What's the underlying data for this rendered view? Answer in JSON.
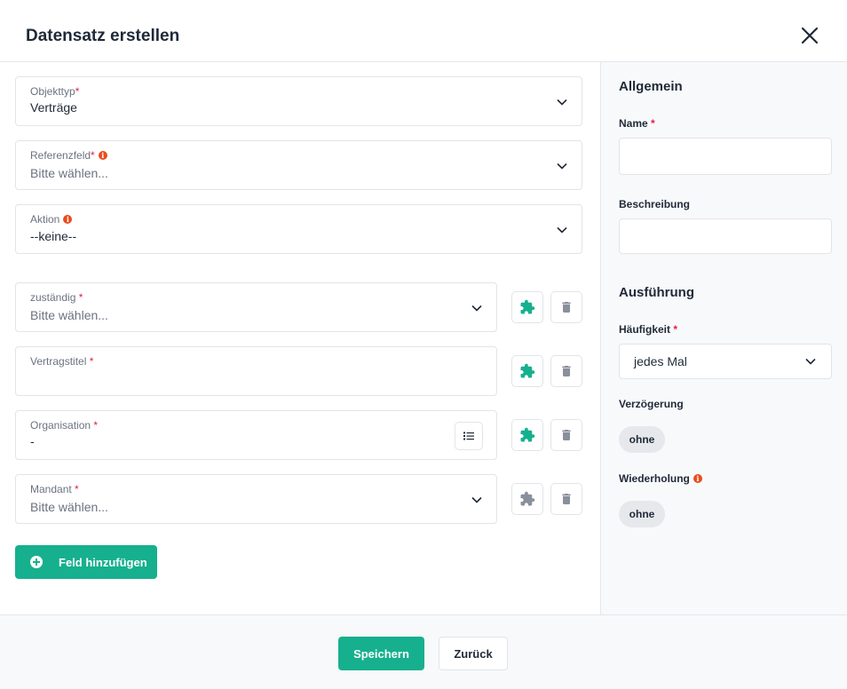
{
  "dialog": {
    "title": "Datensatz erstellen"
  },
  "required_mark": "*",
  "info_glyph": "i",
  "fields": {
    "objekttyp": {
      "label": "Objekttyp",
      "value": "Verträge"
    },
    "referenzfeld": {
      "label": "Referenzfeld",
      "placeholder": "Bitte wählen..."
    },
    "aktion": {
      "label": "Aktion",
      "value": "--keine--"
    },
    "zustaendig": {
      "label": "zuständig",
      "placeholder": "Bitte wählen..."
    },
    "vertragstitel": {
      "label": "Vertragstitel",
      "value": ""
    },
    "organisation": {
      "label": "Organisation",
      "value": "-"
    },
    "mandant": {
      "label": "Mandant",
      "placeholder": "Bitte wählen..."
    }
  },
  "add_field_button": "Feld hinzufügen",
  "sidebar": {
    "general_title": "Allgemein",
    "name_label": "Name",
    "name_value": "",
    "description_label": "Beschreibung",
    "description_value": "",
    "execution_title": "Ausführung",
    "frequency_label": "Häufigkeit",
    "frequency_value": "jedes Mal",
    "delay_label": "Verzögerung",
    "delay_value": "ohne",
    "repeat_label": "Wiederholung",
    "repeat_value": "ohne"
  },
  "footer": {
    "save": "Speichern",
    "back": "Zurück"
  },
  "colors": {
    "accent": "#16b08e",
    "required": "#e11d48",
    "info": "#ea4c1d",
    "puzzle_active": "#16b08e",
    "puzzle_inactive": "#8a8f9c",
    "trash": "#8a8f9c"
  },
  "icons": {
    "close": "close-icon",
    "chevron": "chevron-down-icon",
    "puzzle": "puzzle-icon",
    "trash": "trash-icon",
    "list": "list-icon",
    "plus": "plus-circle-icon",
    "info": "info-icon"
  }
}
